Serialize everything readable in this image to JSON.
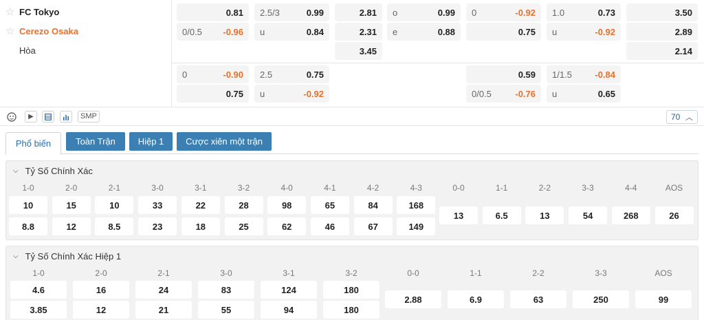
{
  "match": {
    "home_team": "FC Tokyo",
    "away_team": "Cerezo Osaka",
    "draw_label": "Hòa"
  },
  "odds": {
    "row1": {
      "ah_home_odd": "0.81",
      "ou_line": "2.5/3",
      "ou_over_odd": "0.99",
      "x12_home": "2.81",
      "oe_odd_label": "o",
      "oe_odd_value": "0.99",
      "h1_ah_line": "0",
      "h1_ah_home_odd": "-0.92",
      "h1_ou_line": "1.0",
      "h1_ou_over_odd": "0.73",
      "h1_x12_home": "3.50"
    },
    "row2": {
      "ah_line": "0/0.5",
      "ah_away_odd": "-0.96",
      "ou_under_label": "u",
      "ou_under_odd": "0.84",
      "x12_away": "2.31",
      "oe_even_label": "e",
      "oe_even_value": "0.88",
      "h1_ah_away_odd": "0.75",
      "h1_ou_under_label": "u",
      "h1_ou_under_odd": "-0.92",
      "h1_x12_away": "2.89"
    },
    "row3": {
      "x12_draw": "3.45",
      "h1_x12_draw": "2.14"
    },
    "row4": {
      "ah_line": "0",
      "ah_home_odd": "-0.90",
      "ou_line": "2.5",
      "ou_over_odd": "0.75",
      "h1_ah_home_odd": "0.59",
      "h1_ou_line": "1/1.5",
      "h1_ou_over_odd": "-0.84"
    },
    "row5": {
      "ah_away_odd": "0.75",
      "ou_under_label": "u",
      "ou_under_odd": "-0.92",
      "h1_ah_line": "0/0.5",
      "h1_ah_away_odd": "-0.76",
      "h1_ou_under_label": "u",
      "h1_ou_under_odd": "0.65"
    }
  },
  "toolbar": {
    "smp_label": "SMP",
    "count": "70",
    "icons": [
      "stats-icon",
      "play-icon",
      "layout-icon",
      "chart-icon"
    ]
  },
  "tabs": [
    "Phổ biến",
    "Toàn Trận",
    "Hiệp 1",
    "Cược xiên một trận"
  ],
  "correct_score": {
    "title": "Tỷ Số Chính Xác",
    "home_headers": [
      "1-0",
      "2-0",
      "2-1",
      "3-0",
      "3-1",
      "3-2",
      "4-0",
      "4-1",
      "4-2",
      "4-3"
    ],
    "home_row": [
      "10",
      "15",
      "10",
      "33",
      "22",
      "28",
      "98",
      "65",
      "84",
      "168"
    ],
    "away_row": [
      "8.8",
      "12",
      "8.5",
      "23",
      "18",
      "25",
      "62",
      "46",
      "67",
      "149"
    ],
    "draw_headers": [
      "0-0",
      "1-1",
      "2-2",
      "3-3",
      "4-4",
      "AOS"
    ],
    "draw_row": [
      "13",
      "6.5",
      "13",
      "54",
      "268",
      "26"
    ]
  },
  "correct_score_h1": {
    "title": "Tỷ Số Chính Xác Hiệp 1",
    "home_headers": [
      "1-0",
      "2-0",
      "2-1",
      "3-0",
      "3-1",
      "3-2"
    ],
    "home_row": [
      "4.6",
      "16",
      "24",
      "83",
      "124",
      "180"
    ],
    "away_row": [
      "3.85",
      "12",
      "21",
      "55",
      "94",
      "180"
    ],
    "draw_headers": [
      "0-0",
      "1-1",
      "2-2",
      "3-3",
      "AOS"
    ],
    "draw_row": [
      "2.88",
      "6.9",
      "63",
      "250",
      "99"
    ]
  },
  "colors": {
    "negative_odd": "#e8702a",
    "tab_blue": "#3b7fb3"
  }
}
